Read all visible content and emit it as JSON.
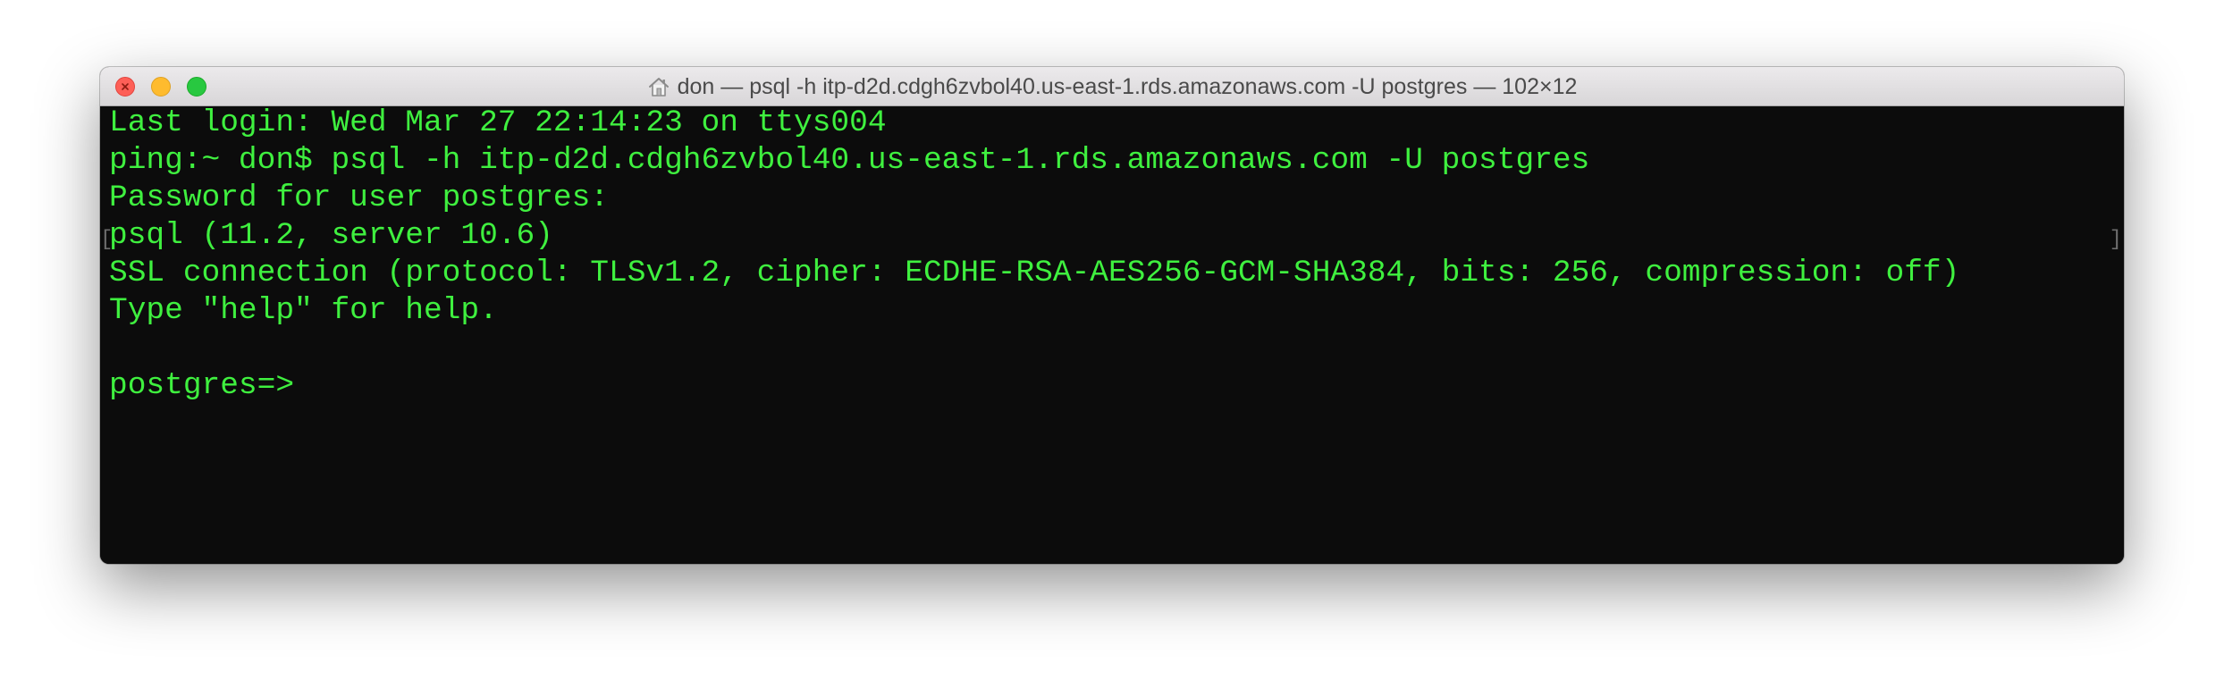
{
  "window": {
    "title": "don — psql -h itp-d2d.cdgh6zvbol40.us-east-1.rds.amazonaws.com -U postgres — 102×12",
    "controls": {
      "close": "close",
      "minimize": "minimize",
      "zoom": "zoom"
    },
    "title_icon": "home-icon"
  },
  "terminal": {
    "lines": [
      "Last login: Wed Mar 27 22:14:23 on ttys004",
      "ping:~ don$ psql -h itp-d2d.cdgh6zvbol40.us-east-1.rds.amazonaws.com -U postgres",
      "Password for user postgres:",
      "psql (11.2, server 10.6)",
      "SSL connection (protocol: TLSv1.2, cipher: ECDHE-RSA-AES256-GCM-SHA384, bits: 256, compression: off)",
      "Type \"help\" for help.",
      "",
      "postgres=>"
    ],
    "selection_marks": [
      "[",
      "]"
    ]
  },
  "colors": {
    "terminal_background": "#0c0c0c",
    "terminal_text": "#3ff03f",
    "close_button": "#fe5f57",
    "minimize_button": "#febb2e",
    "zoom_button": "#28c840"
  }
}
